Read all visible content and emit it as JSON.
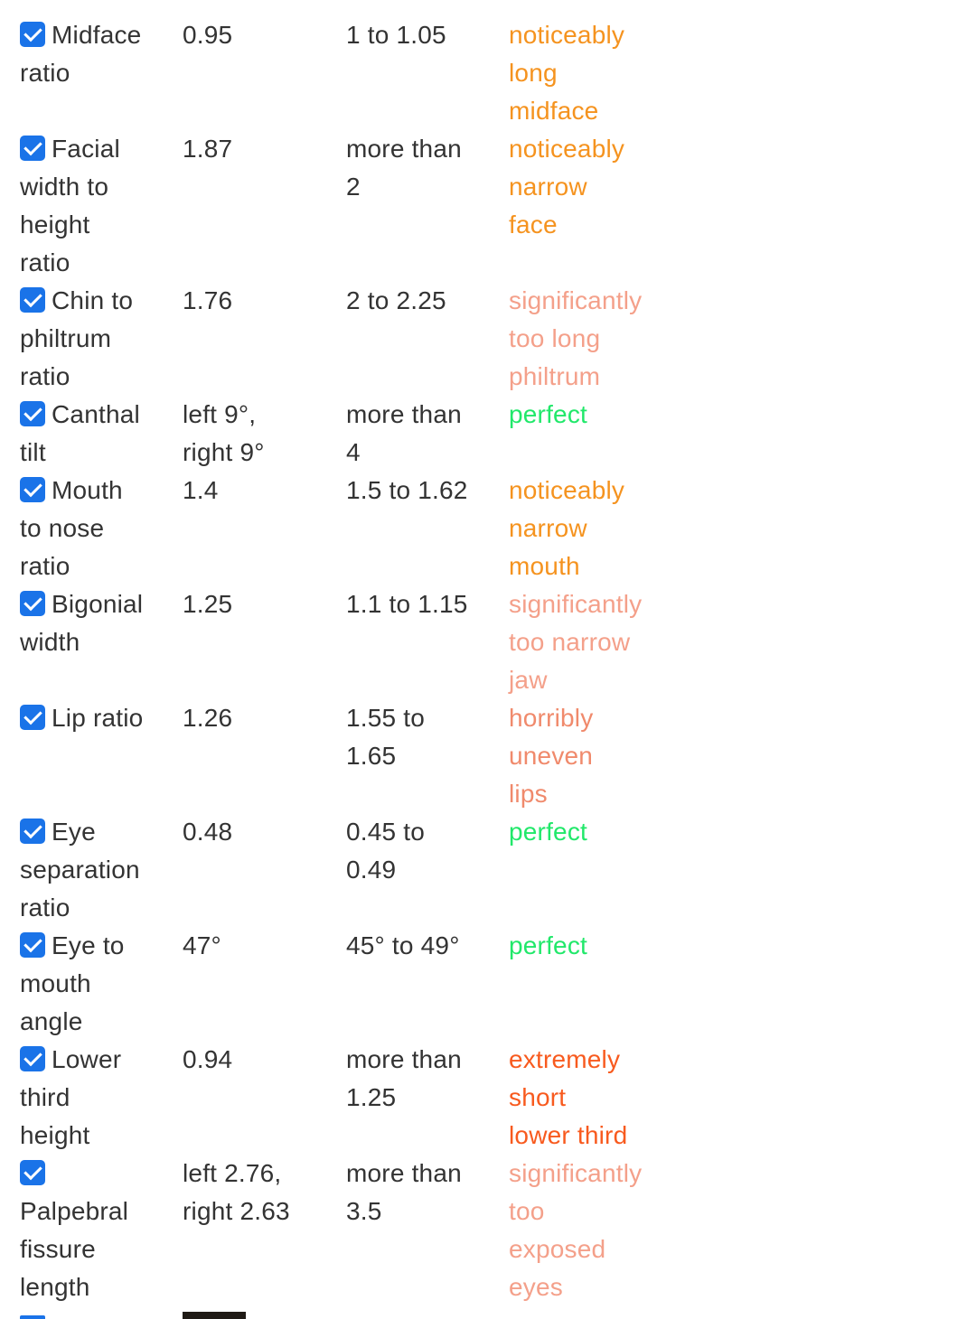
{
  "rows": [
    {
      "name_lines": [
        "Midface",
        "ratio"
      ],
      "value_lines": [
        "0.95"
      ],
      "ideal_lines": [
        "1 to 1.05"
      ],
      "verdict_lines": [
        "noticeably",
        "long",
        "midface"
      ],
      "verdict_color": "#f5931f",
      "checked": true
    },
    {
      "name_lines": [
        "Facial",
        "width to",
        "height",
        "ratio"
      ],
      "value_lines": [
        "1.87"
      ],
      "ideal_lines": [
        "more than",
        "2"
      ],
      "verdict_lines": [
        "noticeably",
        "narrow",
        "face"
      ],
      "verdict_color": "#f5931f",
      "checked": true
    },
    {
      "name_lines": [
        "Chin to",
        "philtrum",
        "ratio"
      ],
      "value_lines": [
        "1.76"
      ],
      "ideal_lines": [
        "2 to 2.25"
      ],
      "verdict_lines": [
        "significantly",
        "too long",
        "philtrum"
      ],
      "verdict_color": "#f4a08a",
      "checked": true
    },
    {
      "name_lines": [
        "Canthal",
        "tilt"
      ],
      "value_lines": [
        "left 9°,",
        "right 9°"
      ],
      "ideal_lines": [
        "more than",
        "4"
      ],
      "verdict_lines": [
        "perfect"
      ],
      "verdict_color": "#21e86a",
      "checked": true
    },
    {
      "name_lines": [
        "Mouth",
        "to nose",
        "ratio"
      ],
      "value_lines": [
        "1.4"
      ],
      "ideal_lines": [
        "1.5 to 1.62"
      ],
      "verdict_lines": [
        "noticeably",
        "narrow",
        "mouth"
      ],
      "verdict_color": "#f5931f",
      "checked": true
    },
    {
      "name_lines": [
        "Bigonial",
        "width"
      ],
      "value_lines": [
        "1.25"
      ],
      "ideal_lines": [
        "1.1 to 1.15"
      ],
      "verdict_lines": [
        "significantly",
        "too narrow",
        "jaw"
      ],
      "verdict_color": "#f4a08a",
      "checked": true
    },
    {
      "name_lines": [
        "Lip ratio"
      ],
      "value_lines": [
        "1.26"
      ],
      "ideal_lines": [
        "1.55 to",
        "1.65"
      ],
      "verdict_lines": [
        "horribly",
        "uneven",
        "lips"
      ],
      "verdict_color": "#f08a6c",
      "checked": true
    },
    {
      "name_lines": [
        "Eye",
        "separation",
        "ratio"
      ],
      "value_lines": [
        "0.48"
      ],
      "ideal_lines": [
        "0.45 to",
        "0.49"
      ],
      "verdict_lines": [
        "perfect"
      ],
      "verdict_color": "#21e86a",
      "checked": true
    },
    {
      "name_lines": [
        "Eye to",
        "mouth",
        "angle"
      ],
      "value_lines": [
        "47°"
      ],
      "ideal_lines": [
        "45° to 49°"
      ],
      "verdict_lines": [
        "perfect"
      ],
      "verdict_color": "#21e86a",
      "checked": true
    },
    {
      "name_lines": [
        "Lower",
        "third",
        "height"
      ],
      "value_lines": [
        "0.94"
      ],
      "ideal_lines": [
        "more than",
        "1.25"
      ],
      "verdict_lines": [
        "extremely",
        "short",
        "lower third"
      ],
      "verdict_color": "#f85a1e",
      "checked": true
    },
    {
      "name_lines": [
        "",
        "Palpebral",
        "fissure",
        "length"
      ],
      "value_lines": [
        "left 2.76,",
        "right 2.63"
      ],
      "ideal_lines": [
        "more than",
        "3.5"
      ],
      "verdict_lines": [
        "significantly",
        "too",
        "exposed",
        "eyes"
      ],
      "verdict_color": "#f4a08a",
      "checked": true
    }
  ]
}
